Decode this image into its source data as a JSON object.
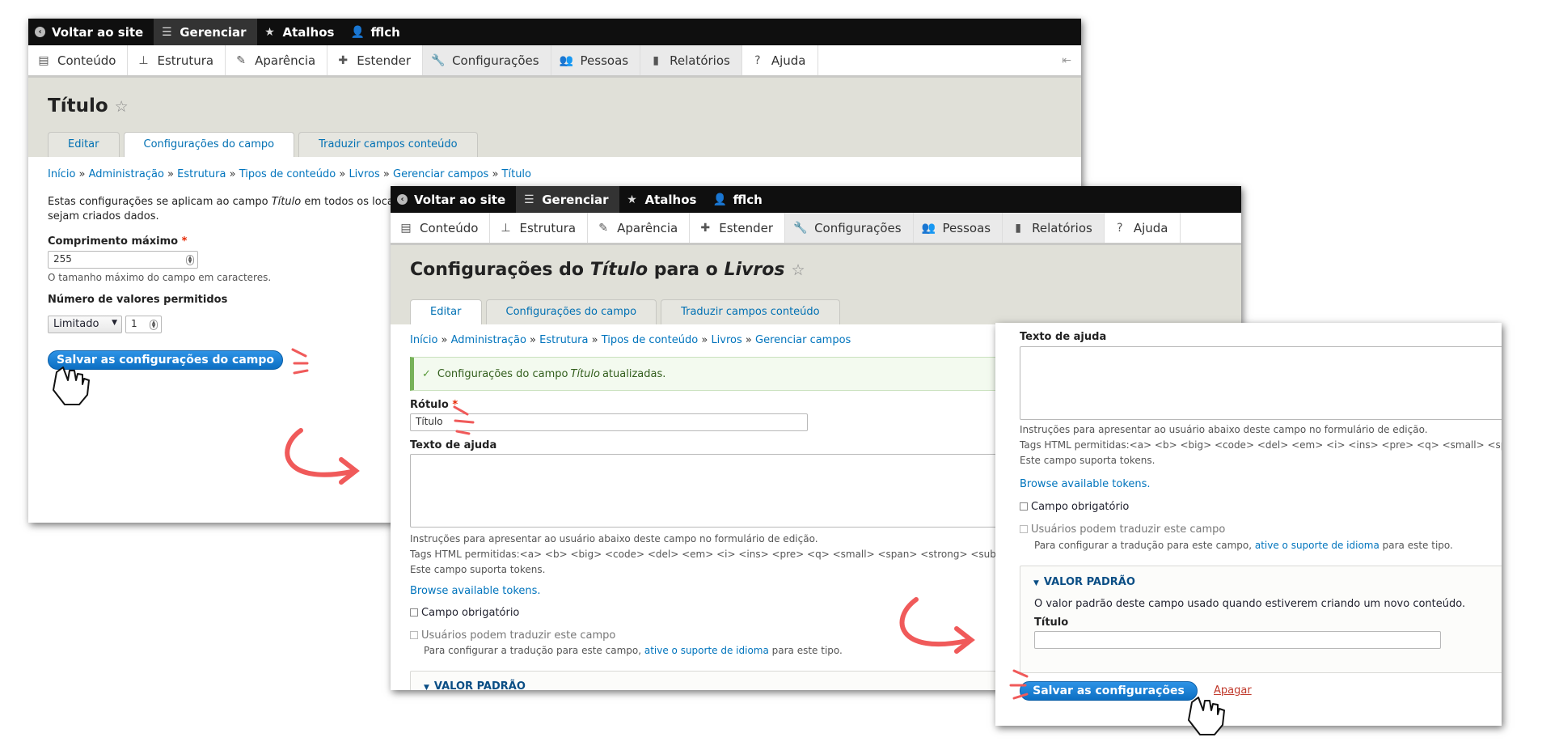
{
  "toolbar": {
    "back": "Voltar ao site",
    "manage": "Gerenciar",
    "shortcuts": "Atalhos",
    "user": "fflch"
  },
  "menu": {
    "content": "Conteúdo",
    "structure": "Estrutura",
    "appearance": "Aparência",
    "extend": "Estender",
    "config": "Configurações",
    "people": "Pessoas",
    "reports": "Relatórios",
    "help": "Ajuda"
  },
  "screen1": {
    "title": "Título",
    "tabs": [
      "Editar",
      "Configurações do campo",
      "Traduzir campos conteúdo"
    ],
    "breadcrumb": [
      "Início",
      "Administração",
      "Estrutura",
      "Tipos de conteúdo",
      "Livros",
      "Gerenciar campos",
      "Título"
    ],
    "desc_1": "Estas configurações se aplicam ao campo ",
    "desc_em": "Título",
    "desc_2": " em todos os locais or",
    "desc_3": "sejam criados dados.",
    "max_length_label": "Comprimento máximo",
    "required_mark": "*",
    "max_length_value": "255",
    "max_length_help": "O tamanho máximo do campo em caracteres.",
    "cardinality_label": "Número de valores permitidos",
    "cardinality_select": "Limitado",
    "cardinality_number": "1",
    "save_button": "Salvar as configurações do campo"
  },
  "screen2": {
    "title_1": "Configurações do ",
    "title_em1": "Título",
    "title_2": " para o ",
    "title_em2": "Livros",
    "tabs": [
      "Editar",
      "Configurações do campo",
      "Traduzir campos conteúdo"
    ],
    "breadcrumb": [
      "Início",
      "Administração",
      "Estrutura",
      "Tipos de conteúdo",
      "Livros",
      "Gerenciar campos"
    ],
    "status_1": "Configurações do campo ",
    "status_em": "Título",
    "status_2": " atualizadas.",
    "label_label": "Rótulo",
    "required_mark": "*",
    "label_value": "Título",
    "help_text_label": "Texto de ajuda",
    "help_instructions": "Instruções para apresentar ao usuário abaixo deste campo no formulário de edição.",
    "allowed_tags": "Tags HTML permitidas:<a> <b> <big> <code> <del> <em> <i> <ins> <pre> <q> <small> <span> <strong> <sub> <su",
    "tokens_support": "Este campo suporta tokens.",
    "browse_tokens": "Browse available tokens.",
    "required_checkbox": "Campo obrigatório",
    "translatable_checkbox": "Usuários podem traduzir este campo",
    "translation_help_1": "Para configurar a tradução para este campo, ",
    "translation_link": "ative o suporte de idioma",
    "translation_help_2": " para este tipo.",
    "default_value_summary": "VALOR PADRÃO"
  },
  "screen3": {
    "help_text_label": "Texto de ajuda",
    "help_instructions": "Instruções para apresentar ao usuário abaixo deste campo no formulário de edição.",
    "allowed_tags": "Tags HTML permitidas:<a> <b> <big> <code> <del> <em> <i> <ins> <pre> <q> <small> <spa",
    "tokens_support": "Este campo suporta tokens.",
    "browse_tokens": "Browse available tokens.",
    "required_checkbox": "Campo obrigatório",
    "translatable_checkbox": "Usuários podem traduzir este campo",
    "translation_help_1": "Para configurar a tradução para este campo, ",
    "translation_link": "ative o suporte de idioma",
    "translation_help_2": " para este tipo.",
    "default_value_summary": "VALOR PADRÃO",
    "default_value_desc": "O valor padrão deste campo usado quando estiverem criando um novo conteúdo.",
    "default_title_label": "Título",
    "save_button": "Salvar as configurações",
    "delete_link": "Apagar"
  },
  "colors": {
    "accent_blue": "#0074bd",
    "button_blue": "#0f7ad6",
    "annotation_red": "#f05a5a",
    "toolbar_black": "#0f0f0f"
  }
}
